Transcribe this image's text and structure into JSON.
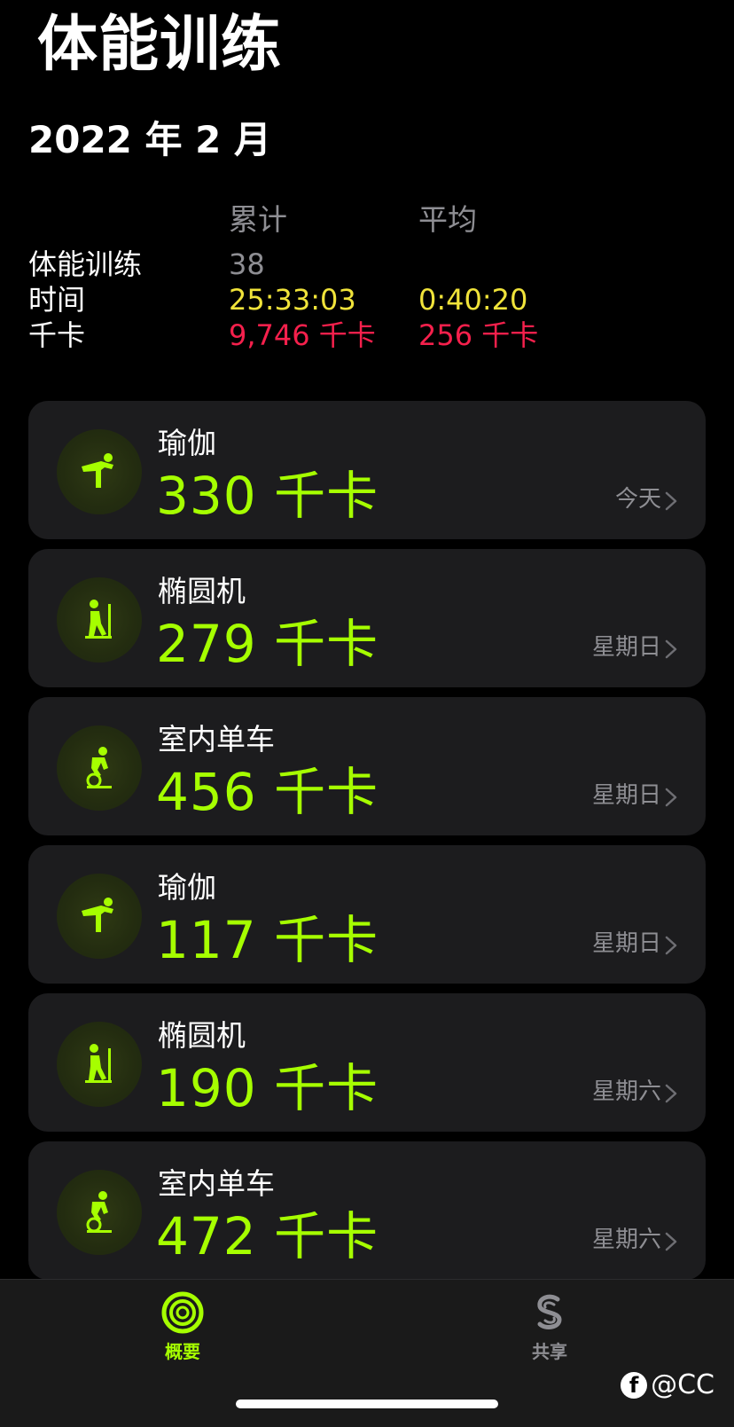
{
  "page": {
    "title": "体能训练"
  },
  "month": {
    "title": "2022 年 2 月"
  },
  "summary": {
    "header_total": "累计",
    "header_avg": "平均",
    "rows": [
      {
        "label": "体能训练",
        "total": "38",
        "avg": ""
      },
      {
        "label": "时间",
        "total": "25:33:03",
        "avg": "0:40:20"
      },
      {
        "label": "千卡",
        "total": "9,746 千卡",
        "avg": "256 千卡"
      }
    ]
  },
  "workouts": [
    {
      "name": "瑜伽",
      "kcal": "330 千卡",
      "day": "今天",
      "icon": "yoga-icon"
    },
    {
      "name": "椭圆机",
      "kcal": "279 千卡",
      "day": "星期日",
      "icon": "elliptical-icon"
    },
    {
      "name": "室内单车",
      "kcal": "456 千卡",
      "day": "星期日",
      "icon": "indoor-cycle-icon"
    },
    {
      "name": "瑜伽",
      "kcal": "117 千卡",
      "day": "星期日",
      "icon": "yoga-icon"
    },
    {
      "name": "椭圆机",
      "kcal": "190 千卡",
      "day": "星期六",
      "icon": "elliptical-icon"
    },
    {
      "name": "室内单车",
      "kcal": "472 千卡",
      "day": "星期六",
      "icon": "indoor-cycle-icon"
    }
  ],
  "tabbar": {
    "summary_label": "概要",
    "sharing_label": "共享"
  },
  "watermark": {
    "text": "@CC",
    "badge": "f"
  },
  "colors": {
    "accent_green": "#a6ff00",
    "time_yellow": "#f0e33a",
    "kcal_red": "#f5204c",
    "card_bg": "#1c1c1e"
  }
}
